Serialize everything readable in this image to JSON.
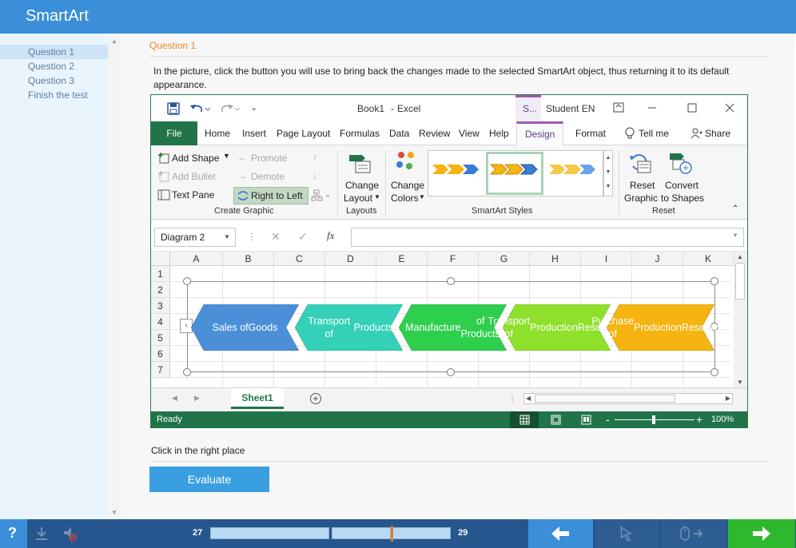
{
  "app": {
    "title": "SmartArt"
  },
  "sidebar": {
    "items": [
      {
        "label": "Question 1",
        "active": true
      },
      {
        "label": "Question 2",
        "active": false
      },
      {
        "label": "Question 3",
        "active": false
      },
      {
        "label": "Finish the test",
        "active": false
      }
    ]
  },
  "question": {
    "title": "Question 1",
    "text": "In the picture, click the button you will use to bring back the changes made to the selected SmartArt object, thus returning it to its default appearance.",
    "hint": "Click in the right place",
    "evaluate_label": "Evaluate"
  },
  "excel": {
    "workbook": "Book1",
    "dash": "-",
    "app": "Excel",
    "context_tab": "S...",
    "user": "Student EN",
    "tabs": [
      "File",
      "Home",
      "Insert",
      "Page Layout",
      "Formulas",
      "Data",
      "Review",
      "View",
      "Help",
      "Design",
      "Format"
    ],
    "tell_me": "Tell me",
    "share": "Share",
    "create_graphic": {
      "add_shape": "Add Shape",
      "add_bullet": "Add Bullet",
      "text_pane": "Text Pane",
      "promote": "Promote",
      "demote": "Demote",
      "right_to_left": "Right to Left",
      "label": "Create Graphic"
    },
    "layouts": {
      "change_layout_1": "Change",
      "change_layout_2": "Layout",
      "label": "Layouts"
    },
    "styles": {
      "change_colors_1": "Change",
      "change_colors_2": "Colors",
      "label": "SmartArt Styles"
    },
    "reset": {
      "reset_graphic_1": "Reset",
      "reset_graphic_2": "Graphic",
      "convert_1": "Convert",
      "convert_2": "to Shapes",
      "label": "Reset"
    },
    "name_box": "Diagram 2",
    "fx": "fx",
    "columns": [
      "A",
      "B",
      "C",
      "D",
      "E",
      "F",
      "G",
      "H",
      "I",
      "J",
      "K"
    ],
    "rows": [
      "1",
      "2",
      "3",
      "4",
      "5",
      "6",
      "7"
    ],
    "smartart": [
      {
        "line1": "Sales of",
        "line2": "Goods",
        "line3": "",
        "color": "#4a8fd8"
      },
      {
        "line1": "Transport of",
        "line2": "Products",
        "line3": "",
        "color": "#35d0b8"
      },
      {
        "line1": "Manufacture",
        "line2": "of Products",
        "line3": "",
        "color": "#2fcf4e"
      },
      {
        "line1": "Transport of",
        "line2": "Production",
        "line3": "Resources",
        "color": "#8ee02a"
      },
      {
        "line1": "Purchase of",
        "line2": "Production",
        "line3": "Resources",
        "color": "#f5b410"
      }
    ],
    "sheet": "Sheet1",
    "status": "Ready",
    "zoom": "100%",
    "zoom_minus": "-",
    "zoom_plus": "+"
  },
  "bottom": {
    "page_start": "27",
    "page_end": "29",
    "progress": 0.51
  }
}
